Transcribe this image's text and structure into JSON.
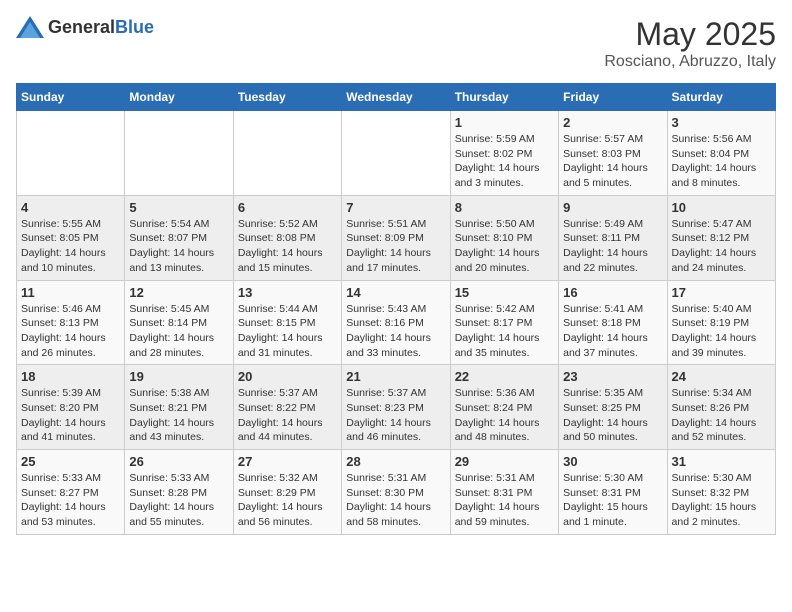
{
  "header": {
    "logo_general": "General",
    "logo_blue": "Blue",
    "title": "May 2025",
    "subtitle": "Rosciano, Abruzzo, Italy"
  },
  "weekdays": [
    "Sunday",
    "Monday",
    "Tuesday",
    "Wednesday",
    "Thursday",
    "Friday",
    "Saturday"
  ],
  "weeks": [
    [
      {
        "day": "",
        "info": ""
      },
      {
        "day": "",
        "info": ""
      },
      {
        "day": "",
        "info": ""
      },
      {
        "day": "",
        "info": ""
      },
      {
        "day": "1",
        "info": "Sunrise: 5:59 AM\nSunset: 8:02 PM\nDaylight: 14 hours and 3 minutes."
      },
      {
        "day": "2",
        "info": "Sunrise: 5:57 AM\nSunset: 8:03 PM\nDaylight: 14 hours and 5 minutes."
      },
      {
        "day": "3",
        "info": "Sunrise: 5:56 AM\nSunset: 8:04 PM\nDaylight: 14 hours and 8 minutes."
      }
    ],
    [
      {
        "day": "4",
        "info": "Sunrise: 5:55 AM\nSunset: 8:05 PM\nDaylight: 14 hours and 10 minutes."
      },
      {
        "day": "5",
        "info": "Sunrise: 5:54 AM\nSunset: 8:07 PM\nDaylight: 14 hours and 13 minutes."
      },
      {
        "day": "6",
        "info": "Sunrise: 5:52 AM\nSunset: 8:08 PM\nDaylight: 14 hours and 15 minutes."
      },
      {
        "day": "7",
        "info": "Sunrise: 5:51 AM\nSunset: 8:09 PM\nDaylight: 14 hours and 17 minutes."
      },
      {
        "day": "8",
        "info": "Sunrise: 5:50 AM\nSunset: 8:10 PM\nDaylight: 14 hours and 20 minutes."
      },
      {
        "day": "9",
        "info": "Sunrise: 5:49 AM\nSunset: 8:11 PM\nDaylight: 14 hours and 22 minutes."
      },
      {
        "day": "10",
        "info": "Sunrise: 5:47 AM\nSunset: 8:12 PM\nDaylight: 14 hours and 24 minutes."
      }
    ],
    [
      {
        "day": "11",
        "info": "Sunrise: 5:46 AM\nSunset: 8:13 PM\nDaylight: 14 hours and 26 minutes."
      },
      {
        "day": "12",
        "info": "Sunrise: 5:45 AM\nSunset: 8:14 PM\nDaylight: 14 hours and 28 minutes."
      },
      {
        "day": "13",
        "info": "Sunrise: 5:44 AM\nSunset: 8:15 PM\nDaylight: 14 hours and 31 minutes."
      },
      {
        "day": "14",
        "info": "Sunrise: 5:43 AM\nSunset: 8:16 PM\nDaylight: 14 hours and 33 minutes."
      },
      {
        "day": "15",
        "info": "Sunrise: 5:42 AM\nSunset: 8:17 PM\nDaylight: 14 hours and 35 minutes."
      },
      {
        "day": "16",
        "info": "Sunrise: 5:41 AM\nSunset: 8:18 PM\nDaylight: 14 hours and 37 minutes."
      },
      {
        "day": "17",
        "info": "Sunrise: 5:40 AM\nSunset: 8:19 PM\nDaylight: 14 hours and 39 minutes."
      }
    ],
    [
      {
        "day": "18",
        "info": "Sunrise: 5:39 AM\nSunset: 8:20 PM\nDaylight: 14 hours and 41 minutes."
      },
      {
        "day": "19",
        "info": "Sunrise: 5:38 AM\nSunset: 8:21 PM\nDaylight: 14 hours and 43 minutes."
      },
      {
        "day": "20",
        "info": "Sunrise: 5:37 AM\nSunset: 8:22 PM\nDaylight: 14 hours and 44 minutes."
      },
      {
        "day": "21",
        "info": "Sunrise: 5:37 AM\nSunset: 8:23 PM\nDaylight: 14 hours and 46 minutes."
      },
      {
        "day": "22",
        "info": "Sunrise: 5:36 AM\nSunset: 8:24 PM\nDaylight: 14 hours and 48 minutes."
      },
      {
        "day": "23",
        "info": "Sunrise: 5:35 AM\nSunset: 8:25 PM\nDaylight: 14 hours and 50 minutes."
      },
      {
        "day": "24",
        "info": "Sunrise: 5:34 AM\nSunset: 8:26 PM\nDaylight: 14 hours and 52 minutes."
      }
    ],
    [
      {
        "day": "25",
        "info": "Sunrise: 5:33 AM\nSunset: 8:27 PM\nDaylight: 14 hours and 53 minutes."
      },
      {
        "day": "26",
        "info": "Sunrise: 5:33 AM\nSunset: 8:28 PM\nDaylight: 14 hours and 55 minutes."
      },
      {
        "day": "27",
        "info": "Sunrise: 5:32 AM\nSunset: 8:29 PM\nDaylight: 14 hours and 56 minutes."
      },
      {
        "day": "28",
        "info": "Sunrise: 5:31 AM\nSunset: 8:30 PM\nDaylight: 14 hours and 58 minutes."
      },
      {
        "day": "29",
        "info": "Sunrise: 5:31 AM\nSunset: 8:31 PM\nDaylight: 14 hours and 59 minutes."
      },
      {
        "day": "30",
        "info": "Sunrise: 5:30 AM\nSunset: 8:31 PM\nDaylight: 15 hours and 1 minute."
      },
      {
        "day": "31",
        "info": "Sunrise: 5:30 AM\nSunset: 8:32 PM\nDaylight: 15 hours and 2 minutes."
      }
    ]
  ]
}
